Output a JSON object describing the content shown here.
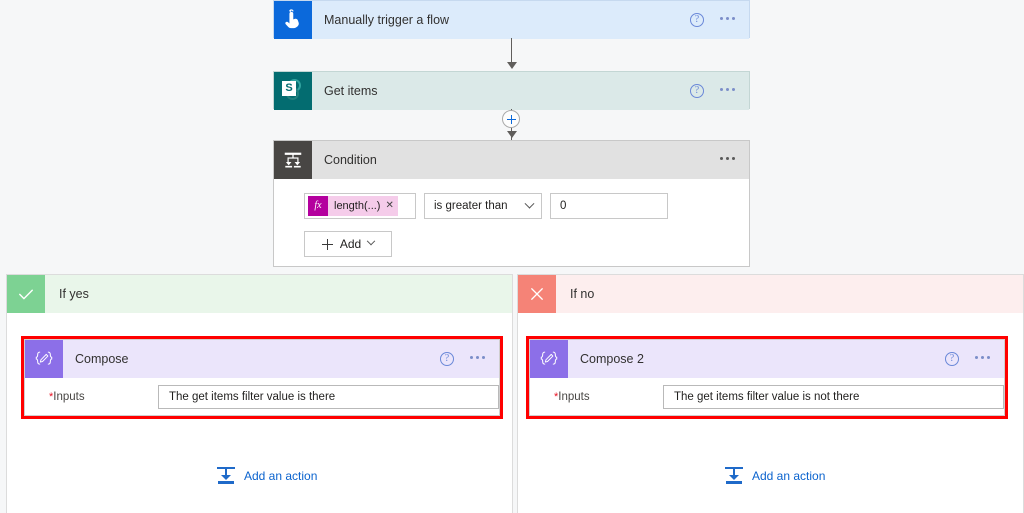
{
  "canvas": {
    "background": "#f6f7f8"
  },
  "flow": {
    "trigger": {
      "title": "Manually trigger a flow",
      "icon": "tap-hand-icon",
      "icon_color": "#0b69db",
      "header_color": "#dcebfb",
      "help_label": "?",
      "menu_label": "..."
    },
    "get_items": {
      "title": "Get items",
      "icon": "sharepoint-icon",
      "icon_color": "#036c70",
      "icon_letter": "S",
      "header_color": "#dbe9e8",
      "help_label": "?",
      "menu_label": "..."
    },
    "insert_button": {
      "label": "+",
      "name": "insert-step-button"
    },
    "condition": {
      "title": "Condition",
      "icon": "condition-branch-icon",
      "icon_color": "#484644",
      "header_color": "#e1e1e1",
      "menu_label": "...",
      "row": {
        "token": {
          "fx_label": "fx",
          "expression": "length(...)",
          "remove_label": "✕",
          "token_bg": "#f5ccea",
          "fx_bg": "#b4009e"
        },
        "operator": "is greater than",
        "value": "0"
      },
      "add_button": {
        "label": "Add",
        "plus": "+",
        "chevron": "chevron-down-icon"
      }
    }
  },
  "branches": [
    {
      "id": "yes",
      "label": "If yes",
      "icon": "checkmark-icon",
      "icon_bg": "#7dd293",
      "header_bg": "#e9f6ea",
      "highlight_color": "#ff0000",
      "action": {
        "title": "Compose",
        "icon": "compose-braces-icon",
        "icon_bg": "#8c6fe8",
        "header_bg": "#ebe5fb",
        "help_label": "?",
        "menu_label": "...",
        "field_label": "Inputs",
        "required_marker": "*",
        "field_value": "The get items filter value is there"
      },
      "add_action_label": "Add an action"
    },
    {
      "id": "no",
      "label": "If no",
      "icon": "close-x-icon",
      "icon_bg": "#f58377",
      "header_bg": "#fdeeee",
      "highlight_color": "#ff0000",
      "action": {
        "title": "Compose 2",
        "icon": "compose-braces-icon",
        "icon_bg": "#8c6fe8",
        "header_bg": "#ebe5fb",
        "help_label": "?",
        "menu_label": "...",
        "field_label": "Inputs",
        "required_marker": "*",
        "field_value": "The get items filter value is not there"
      },
      "add_action_label": "Add an action"
    }
  ]
}
